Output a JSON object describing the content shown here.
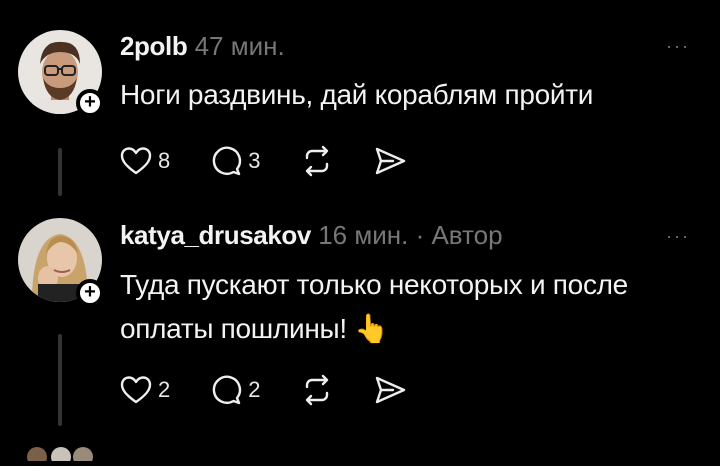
{
  "posts": [
    {
      "username": "2polb",
      "time": "47 мин.",
      "author_badge": "",
      "text": "Ноги раздвинь, дай кораблям пройти",
      "likes": "8",
      "comments": "3",
      "more": "···"
    },
    {
      "username": "katya_drusakov",
      "time": "16 мин.",
      "author_badge": "· Автор",
      "text_line1": "Туда пускают только некоторых и после",
      "text_line2": "оплаты пошлины! 👆",
      "likes": "2",
      "comments": "2",
      "more": "···"
    }
  ],
  "follow_symbol": "+",
  "icons": [
    "heart-icon",
    "comment-icon",
    "repost-icon",
    "share-icon",
    "more-icon"
  ]
}
